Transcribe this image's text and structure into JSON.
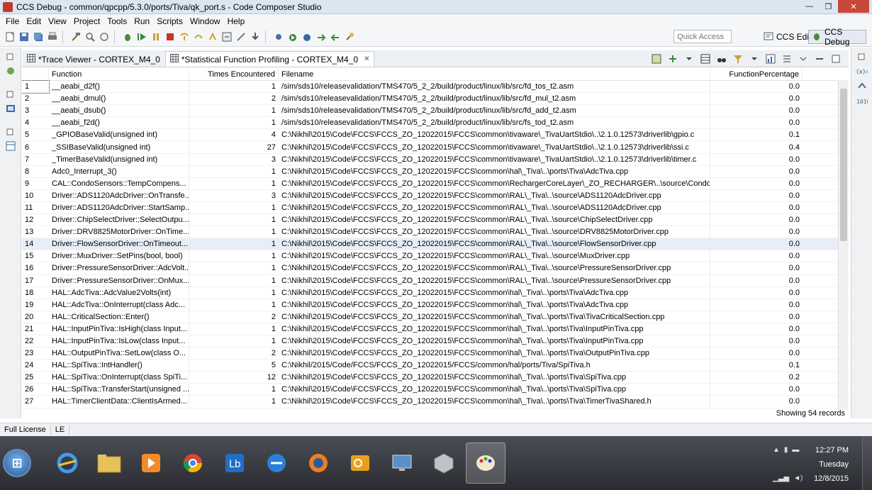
{
  "window": {
    "title": "CCS Debug - common/qpcpp/5.3.0/ports/Tiva/qk_port.s - Code Composer Studio",
    "controls": {
      "minimize": "—",
      "maximize": "❐",
      "close": "✕"
    }
  },
  "menu": [
    "File",
    "Edit",
    "View",
    "Project",
    "Tools",
    "Run",
    "Scripts",
    "Window",
    "Help"
  ],
  "toolbar": {
    "quick_access_placeholder": "Quick Access",
    "perspectives": [
      {
        "label": "CCS Edit",
        "active": false
      },
      {
        "label": "CCS Debug",
        "active": true
      }
    ]
  },
  "tabs": [
    {
      "label": "*Trace Viewer - CORTEX_M4_0",
      "active": false
    },
    {
      "label": "*Statistical Function Profiling - CORTEX_M4_0",
      "active": true,
      "close": "✕"
    }
  ],
  "table": {
    "columns": [
      "Function",
      "Times Encountered",
      "Filename",
      "FunctionPercentage"
    ],
    "rows": [
      [
        "1",
        "__aeabi_d2f()",
        "1",
        "/sim/sds10/releasevalidation/TMS470/5_2_2/build/product/linux/lib/src/fd_tos_t2.asm",
        "0.0"
      ],
      [
        "2",
        "__aeabi_dmul()",
        "2",
        "/sim/sds10/releasevalidation/TMS470/5_2_2/build/product/linux/lib/src/fd_mul_t2.asm",
        "0.0"
      ],
      [
        "3",
        "__aeabi_dsub()",
        "1",
        "/sim/sds10/releasevalidation/TMS470/5_2_2/build/product/linux/lib/src/fd_add_t2.asm",
        "0.0"
      ],
      [
        "4",
        "__aeabi_f2d()",
        "1",
        "/sim/sds10/releasevalidation/TMS470/5_2_2/build/product/linux/lib/src/fs_tod_t2.asm",
        "0.0"
      ],
      [
        "5",
        "_GPIOBaseValid(unsigned int)",
        "4",
        "C:\\Nikhil\\2015\\Code\\FCCS\\FCCS_ZO_12022015\\FCCS\\common\\tivaware\\_TivaUartStdio\\..\\2.1.0.12573\\driverlib\\gpio.c",
        "0.1"
      ],
      [
        "6",
        "_SSIBaseValid(unsigned int)",
        "27",
        "C:\\Nikhil\\2015\\Code\\FCCS\\FCCS_ZO_12022015\\FCCS\\common\\tivaware\\_TivaUartStdio\\..\\2.1.0.12573\\driverlib\\ssi.c",
        "0.4"
      ],
      [
        "7",
        "_TimerBaseValid(unsigned int)",
        "3",
        "C:\\Nikhil\\2015\\Code\\FCCS\\FCCS_ZO_12022015\\FCCS\\common\\tivaware\\_TivaUartStdio\\..\\2.1.0.12573\\driverlib\\timer.c",
        "0.0"
      ],
      [
        "8",
        "Adc0_Interrupt_3()",
        "1",
        "C:\\Nikhil\\2015\\Code\\FCCS\\FCCS_ZO_12022015\\FCCS\\common\\hal\\_Tiva\\..\\ports\\Tiva\\AdcTiva.cpp",
        "0.0"
      ],
      [
        "9",
        "CAL::CondoSensors::TempCompens...",
        "1",
        "C:\\Nikhil\\2015\\Code\\FCCS\\FCCS_ZO_12022015\\FCCS\\common\\RechargerCoreLayer\\_ZO_RECHARGER\\..\\source\\CondoSen...",
        "0.0"
      ],
      [
        "10",
        "Driver::ADS1120AdcDriver::OnTransfe...",
        "3",
        "C:\\Nikhil\\2015\\Code\\FCCS\\FCCS_ZO_12022015\\FCCS\\common\\RAL\\_Tiva\\..\\source\\ADS1120AdcDriver.cpp",
        "0.0"
      ],
      [
        "11",
        "Driver::ADS1120AdcDriver::StartSamp...",
        "1",
        "C:\\Nikhil\\2015\\Code\\FCCS\\FCCS_ZO_12022015\\FCCS\\common\\RAL\\_Tiva\\..\\source\\ADS1120AdcDriver.cpp",
        "0.0"
      ],
      [
        "12",
        "Driver::ChipSelectDriver::SelectOutpu...",
        "1",
        "C:\\Nikhil\\2015\\Code\\FCCS\\FCCS_ZO_12022015\\FCCS\\common\\RAL\\_Tiva\\..\\source\\ChipSelectDriver.cpp",
        "0.0"
      ],
      [
        "13",
        "Driver::DRV8825MotorDriver::OnTime...",
        "1",
        "C:\\Nikhil\\2015\\Code\\FCCS\\FCCS_ZO_12022015\\FCCS\\common\\RAL\\_Tiva\\..\\source\\DRV8825MotorDriver.cpp",
        "0.0"
      ],
      [
        "14",
        "Driver::FlowSensorDriver::OnTimeout...",
        "1",
        "C:\\Nikhil\\2015\\Code\\FCCS\\FCCS_ZO_12022015\\FCCS\\common\\RAL\\_Tiva\\..\\source\\FlowSensorDriver.cpp",
        "0.0"
      ],
      [
        "15",
        "Driver::MuxDriver::SetPins(bool, bool)",
        "1",
        "C:\\Nikhil\\2015\\Code\\FCCS\\FCCS_ZO_12022015\\FCCS\\common\\RAL\\_Tiva\\..\\source\\MuxDriver.cpp",
        "0.0"
      ],
      [
        "16",
        "Driver::PressureSensorDriver::AdcVolt...",
        "1",
        "C:\\Nikhil\\2015\\Code\\FCCS\\FCCS_ZO_12022015\\FCCS\\common\\RAL\\_Tiva\\..\\source\\PressureSensorDriver.cpp",
        "0.0"
      ],
      [
        "17",
        "Driver::PressureSensorDriver::OnMux...",
        "1",
        "C:\\Nikhil\\2015\\Code\\FCCS\\FCCS_ZO_12022015\\FCCS\\common\\RAL\\_Tiva\\..\\source\\PressureSensorDriver.cpp",
        "0.0"
      ],
      [
        "18",
        "HAL::AdcTiva::AdcValue2Volts(int)",
        "1",
        "C:\\Nikhil\\2015\\Code\\FCCS\\FCCS_ZO_12022015\\FCCS\\common\\hal\\_Tiva\\..\\ports\\Tiva\\AdcTiva.cpp",
        "0.0"
      ],
      [
        "19",
        "HAL::AdcTiva::OnInterrupt(class Adc...",
        "1",
        "C:\\Nikhil\\2015\\Code\\FCCS\\FCCS_ZO_12022015\\FCCS\\common\\hal\\_Tiva\\..\\ports\\Tiva\\AdcTiva.cpp",
        "0.0"
      ],
      [
        "20",
        "HAL::CriticalSection::Enter()",
        "2",
        "C:\\Nikhil\\2015\\Code\\FCCS\\FCCS_ZO_12022015\\FCCS\\common\\hal\\_Tiva\\..\\ports\\Tiva\\TivaCriticalSection.cpp",
        "0.0"
      ],
      [
        "21",
        "HAL::InputPinTiva::IsHigh(class Input...",
        "1",
        "C:\\Nikhil\\2015\\Code\\FCCS\\FCCS_ZO_12022015\\FCCS\\common\\hal\\_Tiva\\..\\ports\\Tiva\\InputPinTiva.cpp",
        "0.0"
      ],
      [
        "22",
        "HAL::InputPinTiva::IsLow(class Input...",
        "1",
        "C:\\Nikhil\\2015\\Code\\FCCS\\FCCS_ZO_12022015\\FCCS\\common\\hal\\_Tiva\\..\\ports\\Tiva\\InputPinTiva.cpp",
        "0.0"
      ],
      [
        "23",
        "HAL::OutputPinTiva::SetLow(class O...",
        "2",
        "C:\\Nikhil\\2015\\Code\\FCCS\\FCCS_ZO_12022015\\FCCS\\common\\hal\\_Tiva\\..\\ports\\Tiva\\OutputPinTiva.cpp",
        "0.0"
      ],
      [
        "24",
        "HAL::SpiTiva::IntHandler()",
        "5",
        "C:\\Nikhil/2015/Code/FCCS/FCCS_ZO_12022015/FCCS/common/hal/ports/Tiva/SpiTiva.h",
        "0.1"
      ],
      [
        "25",
        "HAL::SpiTiva::OnInterrupt(class SpiTi...",
        "12",
        "C:\\Nikhil\\2015\\Code\\FCCS\\FCCS_ZO_12022015\\FCCS\\common\\hal\\_Tiva\\..\\ports\\Tiva\\SpiTiva.cpp",
        "0.2"
      ],
      [
        "26",
        "HAL::SpiTiva::TransferStart(unsigned ...",
        "1",
        "C:\\Nikhil\\2015\\Code\\FCCS\\FCCS_ZO_12022015\\FCCS\\common\\hal\\_Tiva\\..\\ports\\Tiva\\SpiTiva.cpp",
        "0.0"
      ],
      [
        "27",
        "HAL::TimerClientData::ClientIsArmed...",
        "1",
        "C:\\Nikhil\\2015\\Code\\FCCS\\FCCS_ZO_12022015\\FCCS\\common\\hal\\_Tiva\\..\\ports\\Tiva\\TimerTivaShared.h",
        "0.0"
      ]
    ],
    "selected_row": 14,
    "focused_row": 1,
    "records_label": "Showing 54 records"
  },
  "status": {
    "license": "Full License",
    "mode": "LE"
  },
  "taskbar": {
    "apps": [
      "internet-explorer",
      "file-explorer",
      "media-player",
      "chrome",
      "lync",
      "teamviewer",
      "firefox",
      "outlook",
      "remote-desktop",
      "virtualbox",
      "paint"
    ],
    "active_app": "paint",
    "clock": {
      "time": "12:27 PM",
      "day": "Tuesday",
      "date": "12/8/2015"
    }
  },
  "colors": {
    "title_bg": "#dbe6f3",
    "selected_row": "#e8eef7",
    "close_red": "#c7473a",
    "taskbar": "#2a2c31"
  }
}
